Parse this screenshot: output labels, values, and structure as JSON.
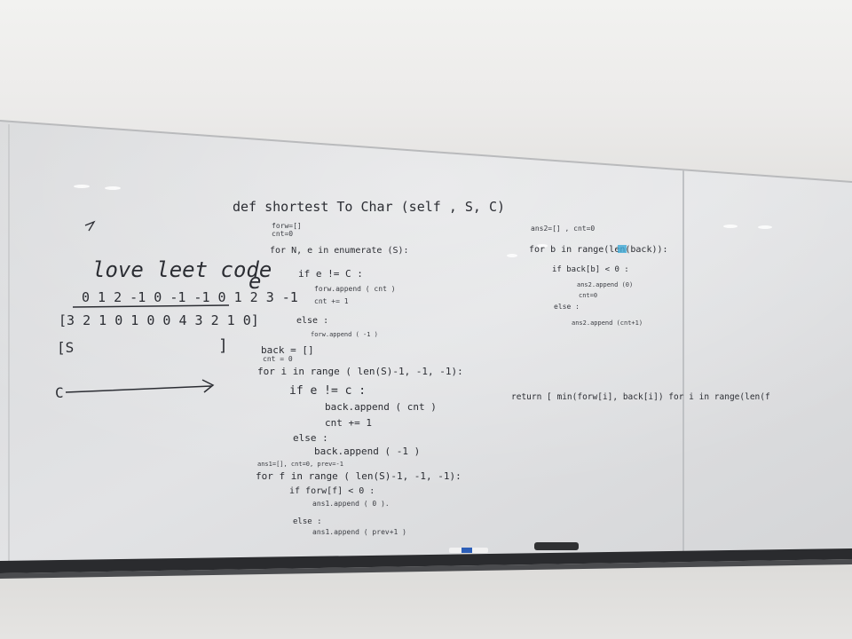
{
  "board": {
    "left_notes": {
      "title": "love leet code",
      "e_char": "e",
      "indices": "0 1 2 -1 0 -1 -1 0   1 2 3 -1",
      "result": "[3 2 1 0 1 0 0 4 3 2 1 0]",
      "s_open": "[S",
      "close_bracket": "]",
      "arrow_label": "C"
    },
    "middle_code": {
      "lines": [
        "def  shortest To Char (self , S, C)",
        "forw=[]",
        "cnt=0",
        "for   N, e   in  enumerate (S):",
        "if  e != C :",
        "forw.append ( cnt )",
        "cnt += 1",
        "else :",
        "forw.append ( -1 )",
        "back = []",
        "cnt = 0",
        "for  i   in   range ( len(S)-1, -1, -1):",
        "if  e != c :",
        "back.append ( cnt )",
        "cnt += 1",
        "else :",
        "back.append ( -1 )",
        "ans1=[], cnt=0, prev=-1",
        "for  f   in   range ( len(S)-1, -1, -1):",
        "if     forw[f] < 0 :",
        "ans1.append ( 0 ).",
        "else :",
        "ans1.append ( prev+1 )"
      ]
    },
    "right_code": {
      "lines": [
        "ans2=[]  , cnt=0",
        "for  b  in   range(len(back)):",
        "if   back[b] < 0 :",
        "ans2.append (0)",
        "cnt=0",
        "else :",
        "ans2.append (cnt+1)",
        "return [  min(forw[i], back[i])  for  i  in  range(len(f"
      ]
    }
  }
}
